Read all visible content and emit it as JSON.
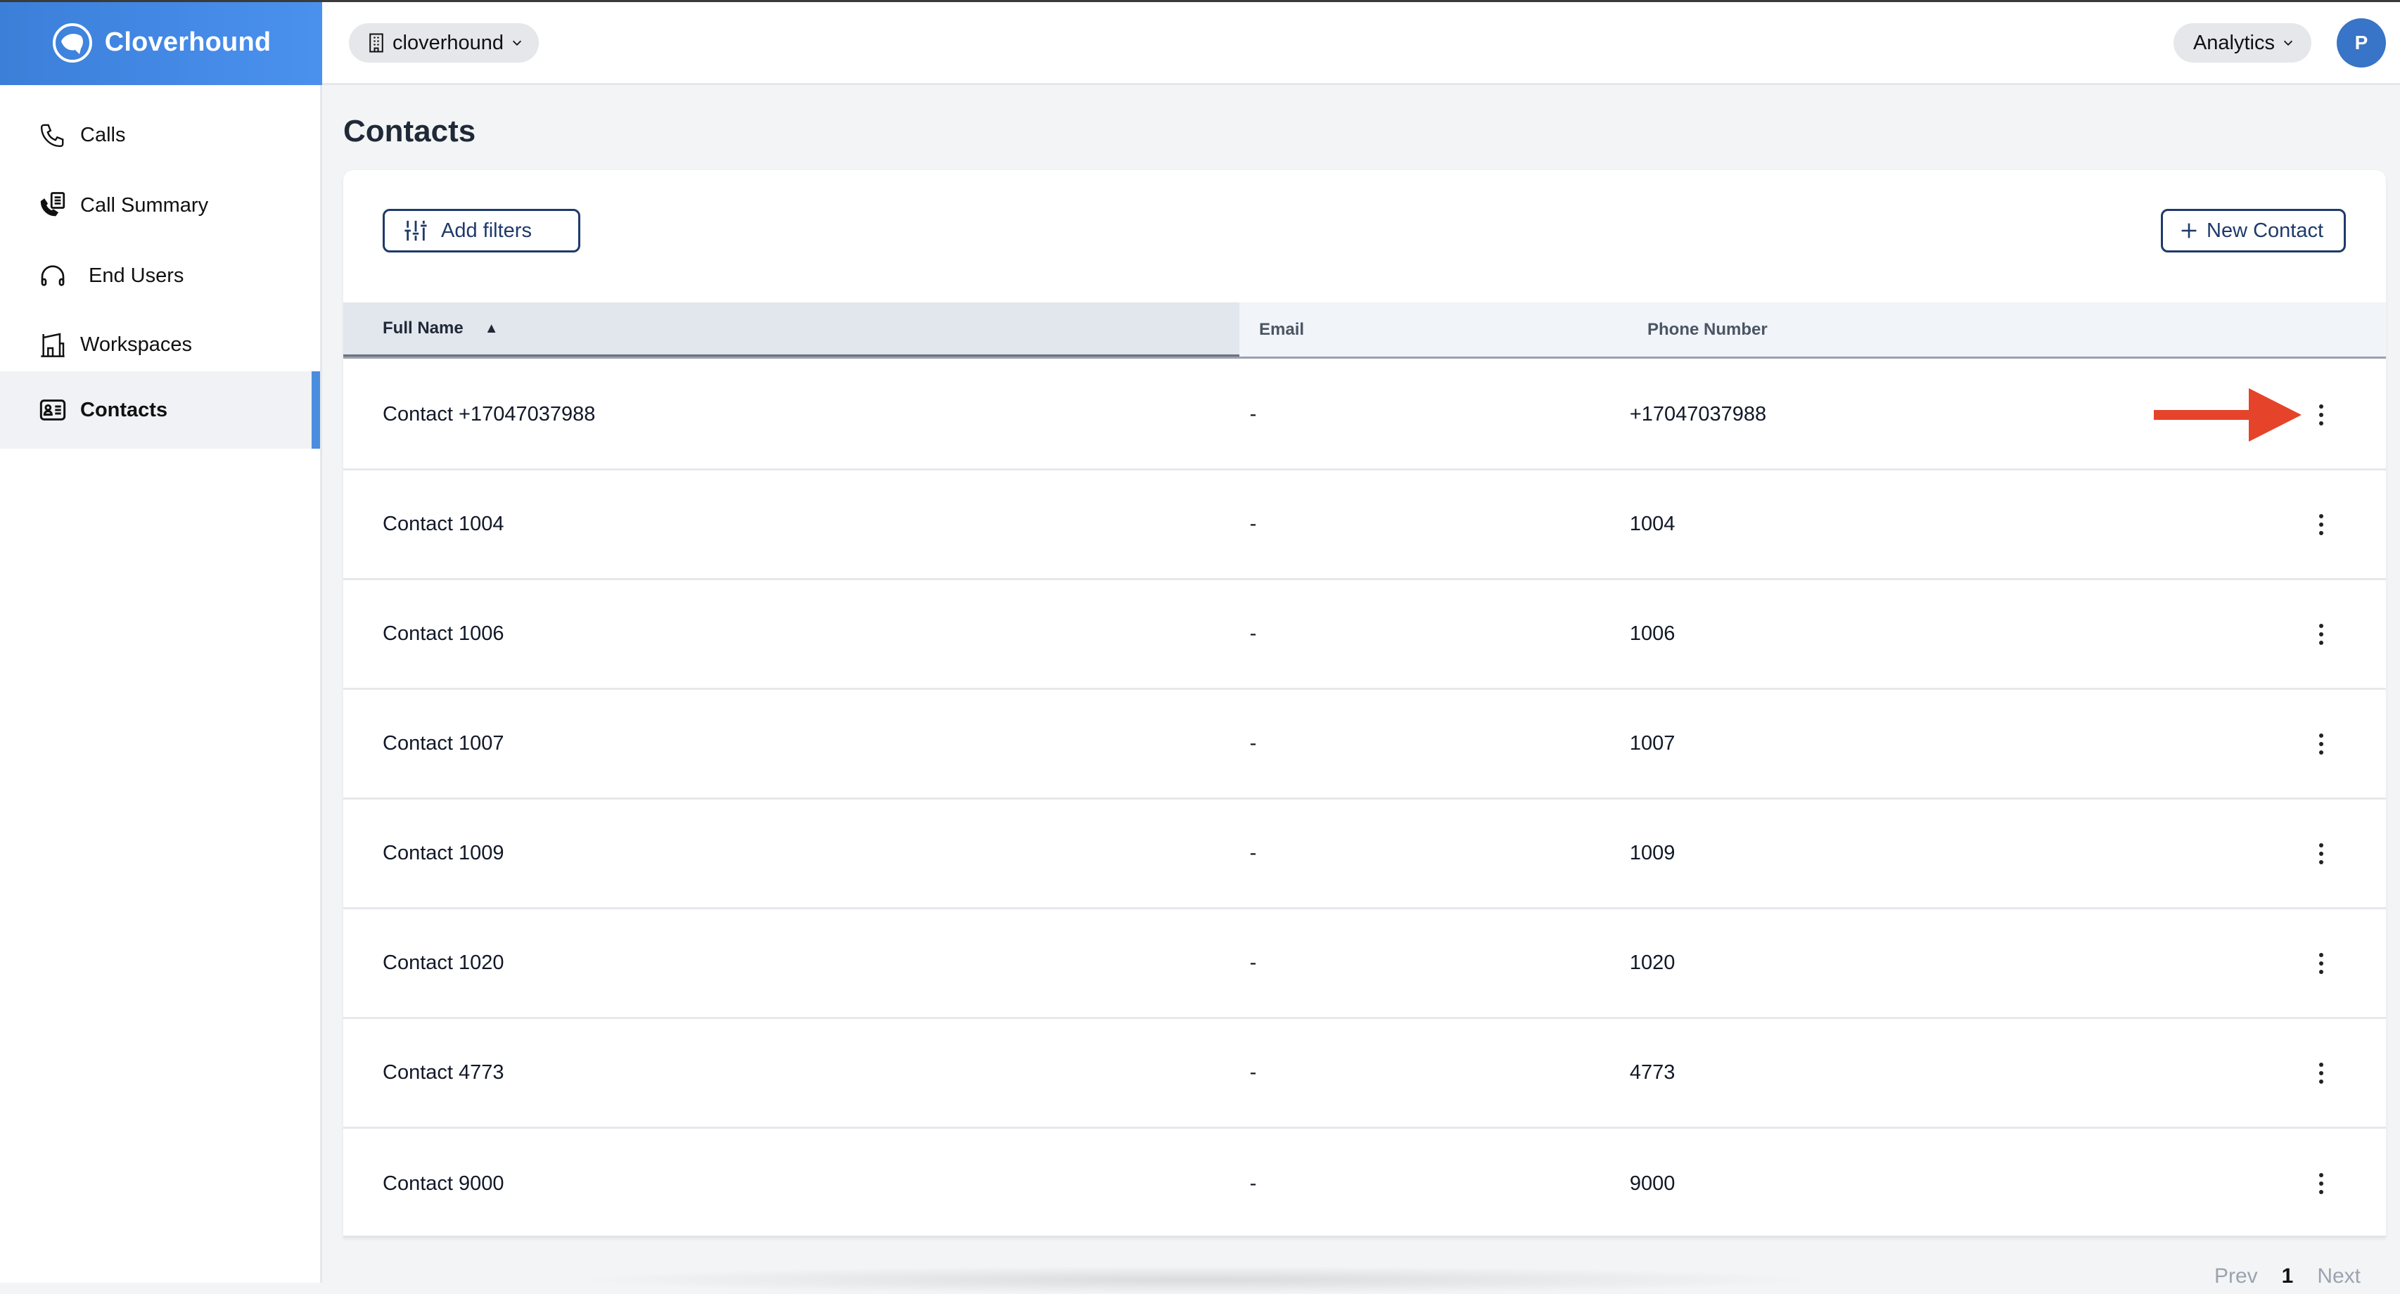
{
  "brand": {
    "name": "Cloverhound"
  },
  "header": {
    "org_selector": "cloverhound",
    "app_menu": "Analytics",
    "avatar_initial": "P"
  },
  "sidebar": {
    "items": [
      {
        "label": "Calls",
        "icon": "phone-icon",
        "active": false
      },
      {
        "label": "Call Summary",
        "icon": "call-summary-icon",
        "active": false
      },
      {
        "label": "End Users",
        "icon": "headphones-icon",
        "active": false
      },
      {
        "label": "Workspaces",
        "icon": "workspaces-icon",
        "active": false
      },
      {
        "label": "Contacts",
        "icon": "contact-card-icon",
        "active": true
      }
    ]
  },
  "page": {
    "title": "Contacts",
    "add_filters_label": "Add filters",
    "new_contact_label": "New Contact"
  },
  "table": {
    "columns": [
      "Full Name",
      "Email",
      "Phone Number"
    ],
    "sort": {
      "column": "Full Name",
      "direction": "ascending"
    },
    "rows": [
      {
        "full_name": "Contact +17047037988",
        "email": "-",
        "phone": "+17047037988"
      },
      {
        "full_name": "Contact 1004",
        "email": "-",
        "phone": "1004"
      },
      {
        "full_name": "Contact 1006",
        "email": "-",
        "phone": "1006"
      },
      {
        "full_name": "Contact 1007",
        "email": "-",
        "phone": "1007"
      },
      {
        "full_name": "Contact 1009",
        "email": "-",
        "phone": "1009"
      },
      {
        "full_name": "Contact 1020",
        "email": "-",
        "phone": "1020"
      },
      {
        "full_name": "Contact 4773",
        "email": "-",
        "phone": "4773"
      },
      {
        "full_name": "Contact 9000",
        "email": "-",
        "phone": "9000"
      }
    ]
  },
  "pagination": {
    "prev": "Prev",
    "current": "1",
    "next": "Next"
  },
  "colors": {
    "brand_blue": "#4a8ddf",
    "button_navy": "#1e3a6b",
    "annotation_red": "#e5432a",
    "avatar_blue": "#3874c7"
  }
}
